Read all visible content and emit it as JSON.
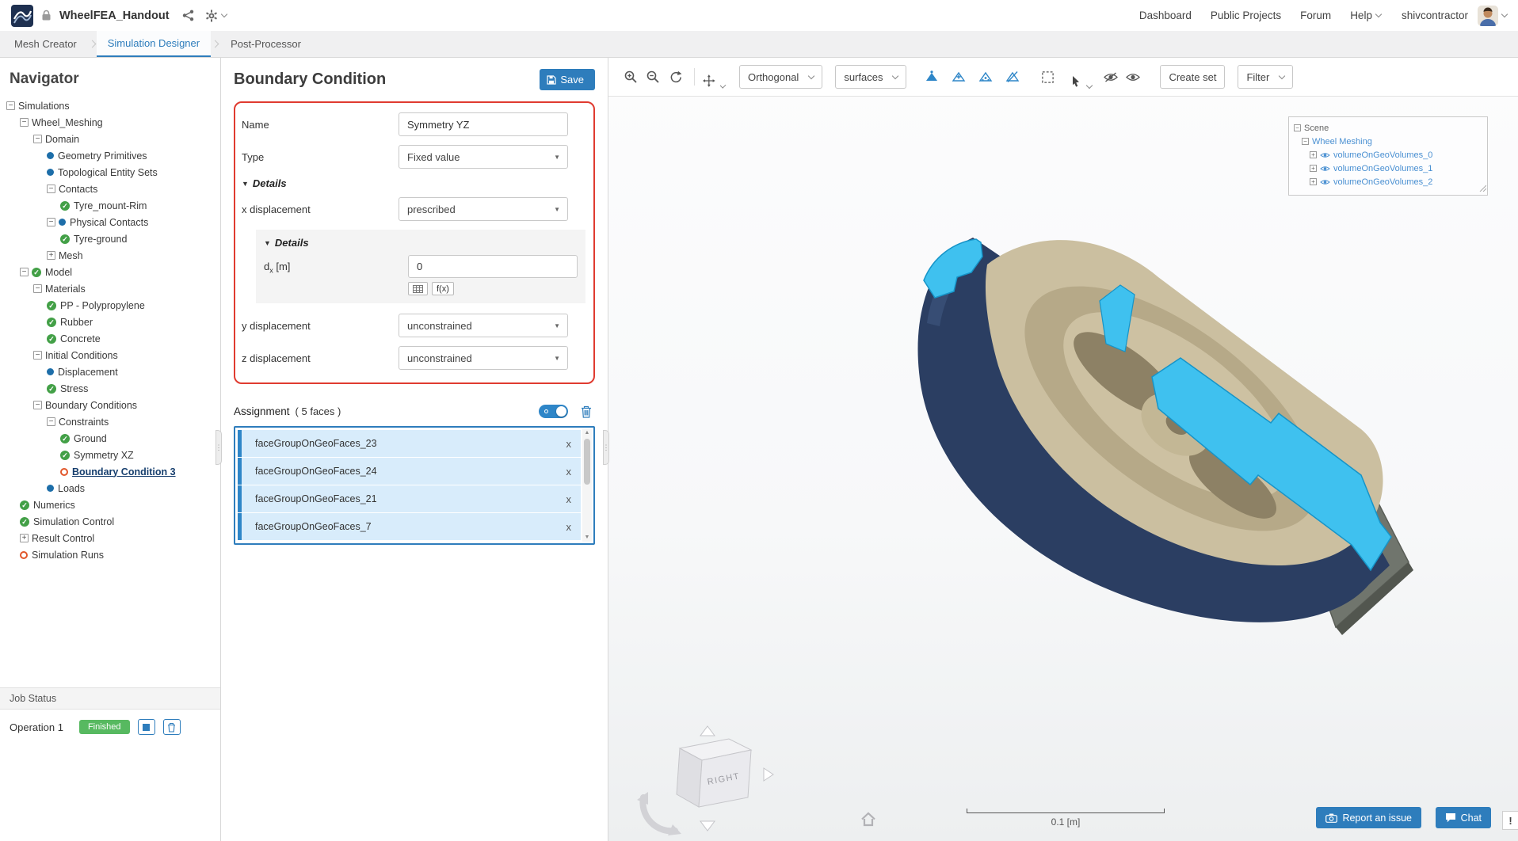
{
  "topbar": {
    "title": "WheelFEA_Handout",
    "nav_items": [
      {
        "label": "Dashboard",
        "caret": false
      },
      {
        "label": "Public Projects",
        "caret": false
      },
      {
        "label": "Forum",
        "caret": false
      },
      {
        "label": "Help",
        "caret": true
      }
    ],
    "username": "shivcontractor"
  },
  "tabs": [
    {
      "label": "Mesh Creator",
      "active": false
    },
    {
      "label": "Simulation Designer",
      "active": true
    },
    {
      "label": "Post-Processor",
      "active": false
    }
  ],
  "navigator": {
    "title": "Navigator",
    "tree": [
      {
        "label": "Simulations",
        "indent": 0,
        "expander": "minus",
        "icon": "none"
      },
      {
        "label": "Wheel_Meshing",
        "indent": 1,
        "expander": "minus",
        "icon": "none"
      },
      {
        "label": "Domain",
        "indent": 2,
        "expander": "minus",
        "icon": "none"
      },
      {
        "label": "Geometry Primitives",
        "indent": 3,
        "expander": "none",
        "icon": "dot"
      },
      {
        "label": "Topological Entity Sets",
        "indent": 3,
        "expander": "none",
        "icon": "dot"
      },
      {
        "label": "Contacts",
        "indent": 3,
        "expander": "minus",
        "icon": "none"
      },
      {
        "label": "Tyre_mount-Rim",
        "indent": 4,
        "expander": "none",
        "icon": "check"
      },
      {
        "label": "Physical Contacts",
        "indent": 3,
        "expander": "minus",
        "icon": "dot"
      },
      {
        "label": "Tyre-ground",
        "indent": 4,
        "expander": "none",
        "icon": "check"
      },
      {
        "label": "Mesh",
        "indent": 3,
        "expander": "plus",
        "icon": "none"
      },
      {
        "label": "Model",
        "indent": 1,
        "expander": "minus",
        "icon": "check"
      },
      {
        "label": "Materials",
        "indent": 2,
        "expander": "minus",
        "icon": "none"
      },
      {
        "label": "PP - Polypropylene",
        "indent": 3,
        "expander": "none",
        "icon": "check"
      },
      {
        "label": "Rubber",
        "indent": 3,
        "expander": "none",
        "icon": "check"
      },
      {
        "label": "Concrete",
        "indent": 3,
        "expander": "none",
        "icon": "check"
      },
      {
        "label": "Initial Conditions",
        "indent": 2,
        "expander": "minus",
        "icon": "none"
      },
      {
        "label": "Displacement",
        "indent": 3,
        "expander": "none",
        "icon": "dot"
      },
      {
        "label": "Stress",
        "indent": 3,
        "expander": "none",
        "icon": "check"
      },
      {
        "label": "Boundary Conditions",
        "indent": 2,
        "expander": "minus",
        "icon": "none"
      },
      {
        "label": "Constraints",
        "indent": 3,
        "expander": "minus",
        "icon": "none"
      },
      {
        "label": "Ground",
        "indent": 4,
        "expander": "none",
        "icon": "check"
      },
      {
        "label": "Symmetry XZ",
        "indent": 4,
        "expander": "none",
        "icon": "check"
      },
      {
        "label": "Boundary Condition 3",
        "indent": 4,
        "expander": "none",
        "icon": "circle-orange",
        "selected": true
      },
      {
        "label": "Loads",
        "indent": 3,
        "expander": "none",
        "icon": "dot"
      },
      {
        "label": "Numerics",
        "indent": 1,
        "expander": "none",
        "icon": "check"
      },
      {
        "label": "Simulation Control",
        "indent": 1,
        "expander": "none",
        "icon": "check"
      },
      {
        "label": "Result Control",
        "indent": 1,
        "expander": "plus",
        "icon": "none"
      },
      {
        "label": "Simulation Runs",
        "indent": 1,
        "expander": "none",
        "icon": "circle-orange"
      }
    ],
    "job_status": {
      "title": "Job Status",
      "operation": "Operation 1",
      "badge": "Finished"
    }
  },
  "panel": {
    "title": "Boundary Condition",
    "save_label": "Save",
    "name_label": "Name",
    "name_value": "Symmetry YZ",
    "type_label": "Type",
    "type_value": "Fixed value",
    "details_label": "Details",
    "x_label": "x displacement",
    "x_value": "prescribed",
    "inner_details_label": "Details",
    "dx_label_main": "d",
    "dx_label_sub": "x",
    "dx_label_unit": " [m]",
    "dx_value": "0",
    "fx_label": "f(x)",
    "y_label": "y displacement",
    "y_value": "unconstrained",
    "z_label": "z displacement",
    "z_value": "unconstrained",
    "assignment_label": "Assignment",
    "assignment_count": "( 5 faces )",
    "remove_label": "x",
    "faces": [
      {
        "name": "faceGroupOnGeoFaces_23"
      },
      {
        "name": "faceGroupOnGeoFaces_24"
      },
      {
        "name": "faceGroupOnGeoFaces_21"
      },
      {
        "name": "faceGroupOnGeoFaces_7"
      }
    ]
  },
  "viewport": {
    "toolbar": {
      "orthogonal_label": "Orthogonal",
      "surfaces_label": "surfaces",
      "create_set_label": "Create set",
      "filter_label": "Filter"
    },
    "scene_tree": {
      "scene_label": "Scene",
      "mesh_label": "Wheel Meshing",
      "volumes": [
        {
          "name": "volumeOnGeoVolumes_0"
        },
        {
          "name": "volumeOnGeoVolumes_1"
        },
        {
          "name": "volumeOnGeoVolumes_2"
        }
      ]
    },
    "cube_face_label": "RIGHT",
    "scale_label": "0.1 [m]",
    "report_issue_label": "Report an issue",
    "chat_label": "Chat",
    "alert_label": "!"
  },
  "colors": {
    "accent_blue": "#2e7dbc",
    "annotation_red": "#e03b30",
    "success_green": "#57b960",
    "selection_blue": "#d8ecfb",
    "model_tan": "#cbbfa0",
    "model_navy": "#2b3e62",
    "model_cyan": "#3fc1ef"
  }
}
